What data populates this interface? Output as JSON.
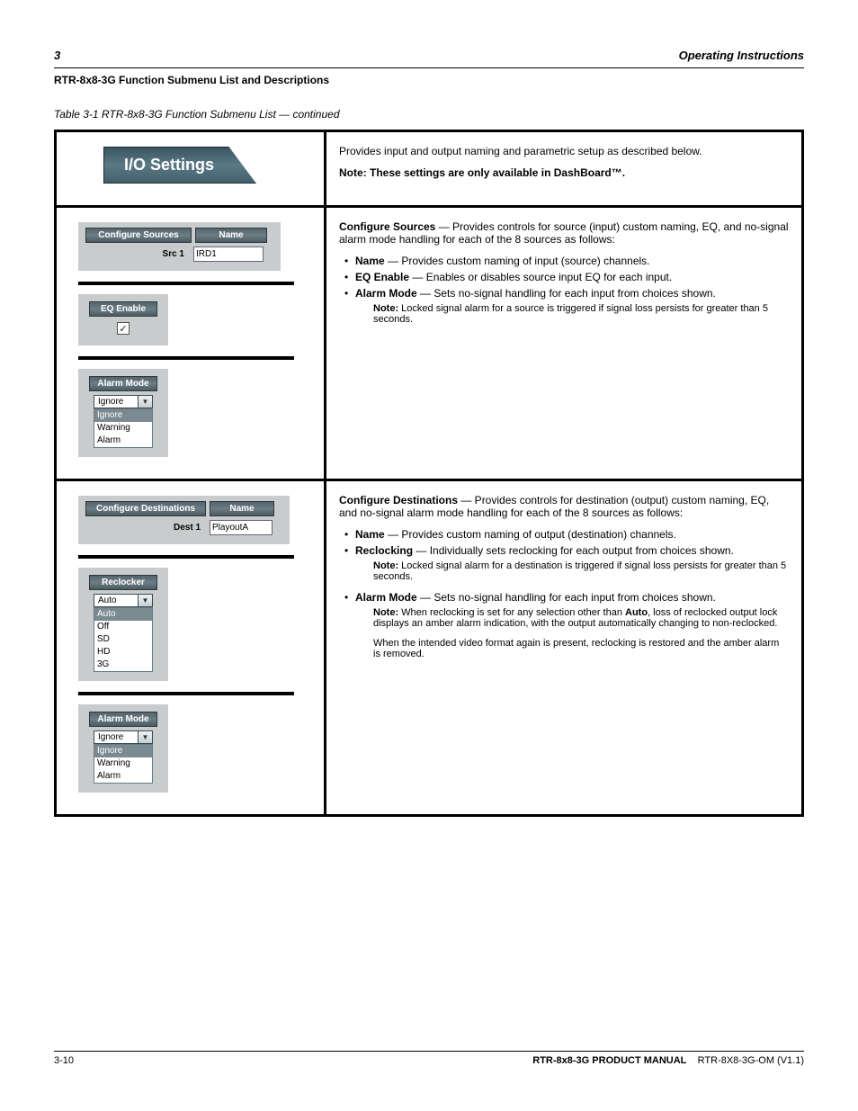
{
  "header": {
    "left": "3",
    "right": "Operating Instructions"
  },
  "chapterLine": "RTR-8x8-3G Function Submenu List and Descriptions",
  "instruction": "Table 3-1  RTR-8x8-3G Function Submenu List — continued",
  "ioButton": "I/O Settings",
  "row1": {
    "right": {
      "intro": "Provides input and output naming and parametric setup as described below.",
      "note": "Note: These settings are only available in DashBoard™."
    }
  },
  "row2": {
    "configSources": {
      "hdrLeft": "Configure Sources",
      "hdrRight": "Name",
      "lbl": "Src 1",
      "value": "IRD1"
    },
    "eqEnable": {
      "hdr": "EQ Enable",
      "checked": true
    },
    "alarmMode": {
      "hdr": "Alarm Mode",
      "selected": "Ignore",
      "opts": [
        "Ignore",
        "Warning",
        "Alarm"
      ]
    },
    "right": {
      "head": "Configure Sources",
      "p1": " — Provides controls for source (input) custom naming, EQ, and no-signal alarm mode handling for each of the 8 sources as follows:",
      "b1lbl": "Name",
      "b1txt": " — Provides custom naming of input (source) channels.",
      "b2lbl": "EQ Enable",
      "b2txt": " — Enables or disables source input EQ for each input.",
      "b3lbl": "Alarm Mode",
      "b3txt": " — Sets no-signal handling for each input from choices shown.",
      "noteLbl": "Note:",
      "noteTxt": " Locked signal alarm for a source is triggered if signal loss persists for greater than 5 seconds."
    }
  },
  "row3": {
    "configDest": {
      "hdrLeft": "Configure Destinations",
      "hdrRight": "Name",
      "lbl": "Dest 1",
      "value": "PlayoutA"
    },
    "reclocker": {
      "hdr": "Reclocker",
      "selected": "Auto",
      "opts": [
        "Auto",
        "Off",
        "SD",
        "HD",
        "3G"
      ]
    },
    "alarmMode": {
      "hdr": "Alarm Mode",
      "selected": "Ignore",
      "opts": [
        "Ignore",
        "Warning",
        "Alarm"
      ]
    },
    "right": {
      "head": "Configure Destinations",
      "p1": " — Provides controls for destination (output) custom naming, EQ, and no-signal alarm mode handling for each of the 8 sources as follows:",
      "b1lbl": "Name",
      "b1txt": " — Provides custom naming of output (destination) channels.",
      "b2lbl": "Reclocking",
      "b2txt": " — Individually sets reclocking for each output from choices shown.",
      "noteLbl1": "Note:",
      "noteTxt1": " Locked signal alarm for a destination is triggered if signal loss persists for greater than 5 seconds.",
      "b3lbl": "Alarm Mode",
      "b3txt": " — Sets no-signal handling for each input from choices shown.",
      "noteLbl2": "Note:",
      "noteTxt2a": " When reclocking is set for any selection other than ",
      "noteTxt2auto": "Auto",
      "noteTxt2b": ", loss of reclocked output lock displays an amber alarm indication, with the output automatically changing to non-reclocked.",
      "noteTxt2c": "When the intended video format again is present, reclocking is restored and the amber alarm is removed."
    }
  },
  "footer": {
    "left": "3-10",
    "right": "RTR-8x8-3G PRODUCT MANUAL",
    "rev": "RTR-8X8-3G-OM (V1.1)"
  }
}
